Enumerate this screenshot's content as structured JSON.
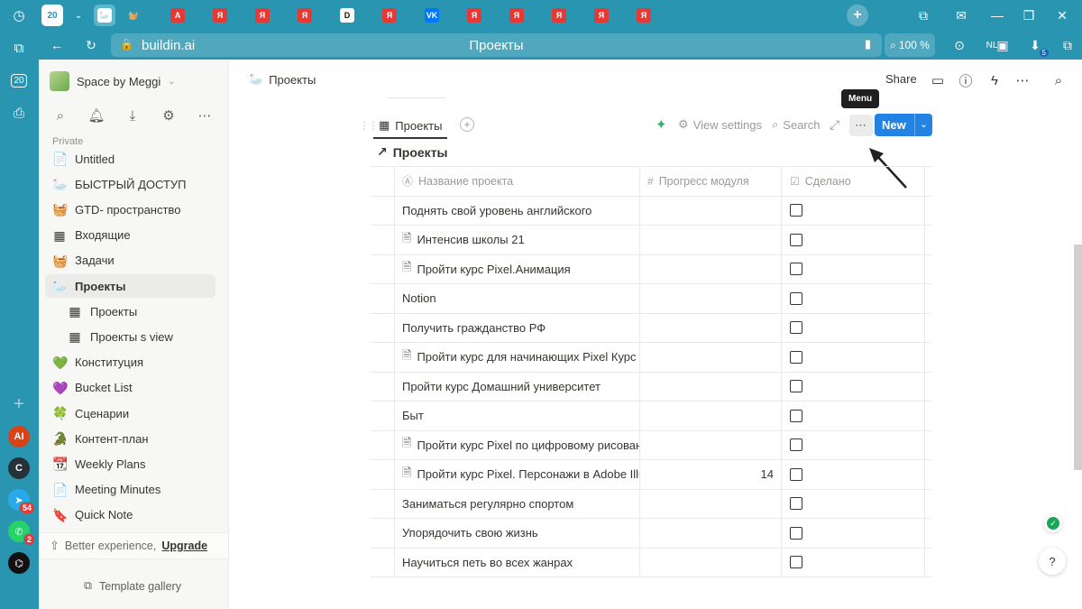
{
  "browser": {
    "tab_count": "20",
    "address": "buildin.ai",
    "page_title": "Проекты",
    "zoom": "100 %",
    "lang_badge": "NL",
    "downloads_badge": "5",
    "left_counter": "20",
    "tabs": [
      "А",
      "Я",
      "Я",
      "Я",
      "D",
      "Я",
      "VK",
      "Я",
      "Я",
      "Я",
      "Я",
      "Я"
    ],
    "apps": [
      {
        "label": "AI",
        "badge": ""
      },
      {
        "label": "C",
        "badge": ""
      },
      {
        "label": "➤",
        "badge": "54"
      },
      {
        "label": "✆",
        "badge": "2"
      },
      {
        "label": "⌬",
        "badge": ""
      }
    ]
  },
  "sidebar": {
    "workspace": "Space by Meggi",
    "section": "Private",
    "items": [
      {
        "icon": "📄",
        "label": "Untitled"
      },
      {
        "icon": "🦢",
        "label": "БЫСТРЫЙ ДОСТУП"
      },
      {
        "icon": "🧺",
        "label": "GTD- пространство"
      },
      {
        "icon": "▦",
        "label": "Входящие"
      },
      {
        "icon": "🧺",
        "label": "Задачи"
      },
      {
        "icon": "🦢",
        "label": "Проекты"
      },
      {
        "icon": "▦",
        "label": "Проекты"
      },
      {
        "icon": "▦",
        "label": "Проекты s view"
      },
      {
        "icon": "💚",
        "label": "Конституция"
      },
      {
        "icon": "💜",
        "label": "Bucket List"
      },
      {
        "icon": "🍀",
        "label": "Сценарии"
      },
      {
        "icon": "🐊",
        "label": "Контент-план"
      },
      {
        "icon": "📆",
        "label": "Weekly Plans"
      },
      {
        "icon": "📄",
        "label": "Meeting Minutes"
      },
      {
        "icon": "🔖",
        "label": "Quick Note"
      }
    ],
    "upgrade_text": "Better experience,",
    "upgrade_link": "Upgrade",
    "template_gallery": "Template gallery"
  },
  "topbar": {
    "breadcrumb_icon": "🦢",
    "breadcrumb": "Проекты",
    "share": "Share",
    "tooltip": "Menu"
  },
  "view": {
    "tab_label": "Проекты",
    "settings": "View settings",
    "search": "Search",
    "new": "New",
    "db_title": "Проекты"
  },
  "table": {
    "columns": [
      "Название проекта",
      "Прогресс модуля",
      "Сделано"
    ],
    "rows": [
      {
        "name": "Поднять свой уровень английского",
        "doc": false,
        "progress": "",
        "done": false
      },
      {
        "name": "Интенсив школы 21",
        "doc": true,
        "progress": "",
        "done": false
      },
      {
        "name": "Пройти курс Pixel.Анимация",
        "doc": true,
        "progress": "",
        "done": false
      },
      {
        "name": "Notion",
        "doc": false,
        "progress": "",
        "done": false
      },
      {
        "name": "Получить гражданство РФ",
        "doc": false,
        "progress": "",
        "done": false
      },
      {
        "name": "Пройти курс для начинающих Pixel Курс ан",
        "doc": true,
        "progress": "",
        "done": false
      },
      {
        "name": "Пройти курс Домашний университет",
        "doc": false,
        "progress": "",
        "done": false
      },
      {
        "name": "Быт",
        "doc": false,
        "progress": "",
        "done": false
      },
      {
        "name": "Пройти курс Pixel по цифровому рисовани",
        "doc": true,
        "progress": "",
        "done": false
      },
      {
        "name": "Пройти курс Pixel. Персонажи в Adobe Illus",
        "doc": true,
        "progress": "14",
        "done": false
      },
      {
        "name": "Заниматься регулярно спортом",
        "doc": false,
        "progress": "",
        "done": false
      },
      {
        "name": "Упорядочить свою жизнь",
        "doc": false,
        "progress": "",
        "done": false
      },
      {
        "name": "Научиться петь во всех жанрах",
        "doc": false,
        "progress": "",
        "done": false
      }
    ]
  },
  "colors": {
    "browser": "#2a95b0",
    "accent": "#2383e2",
    "ai_green": "#2bb673"
  }
}
